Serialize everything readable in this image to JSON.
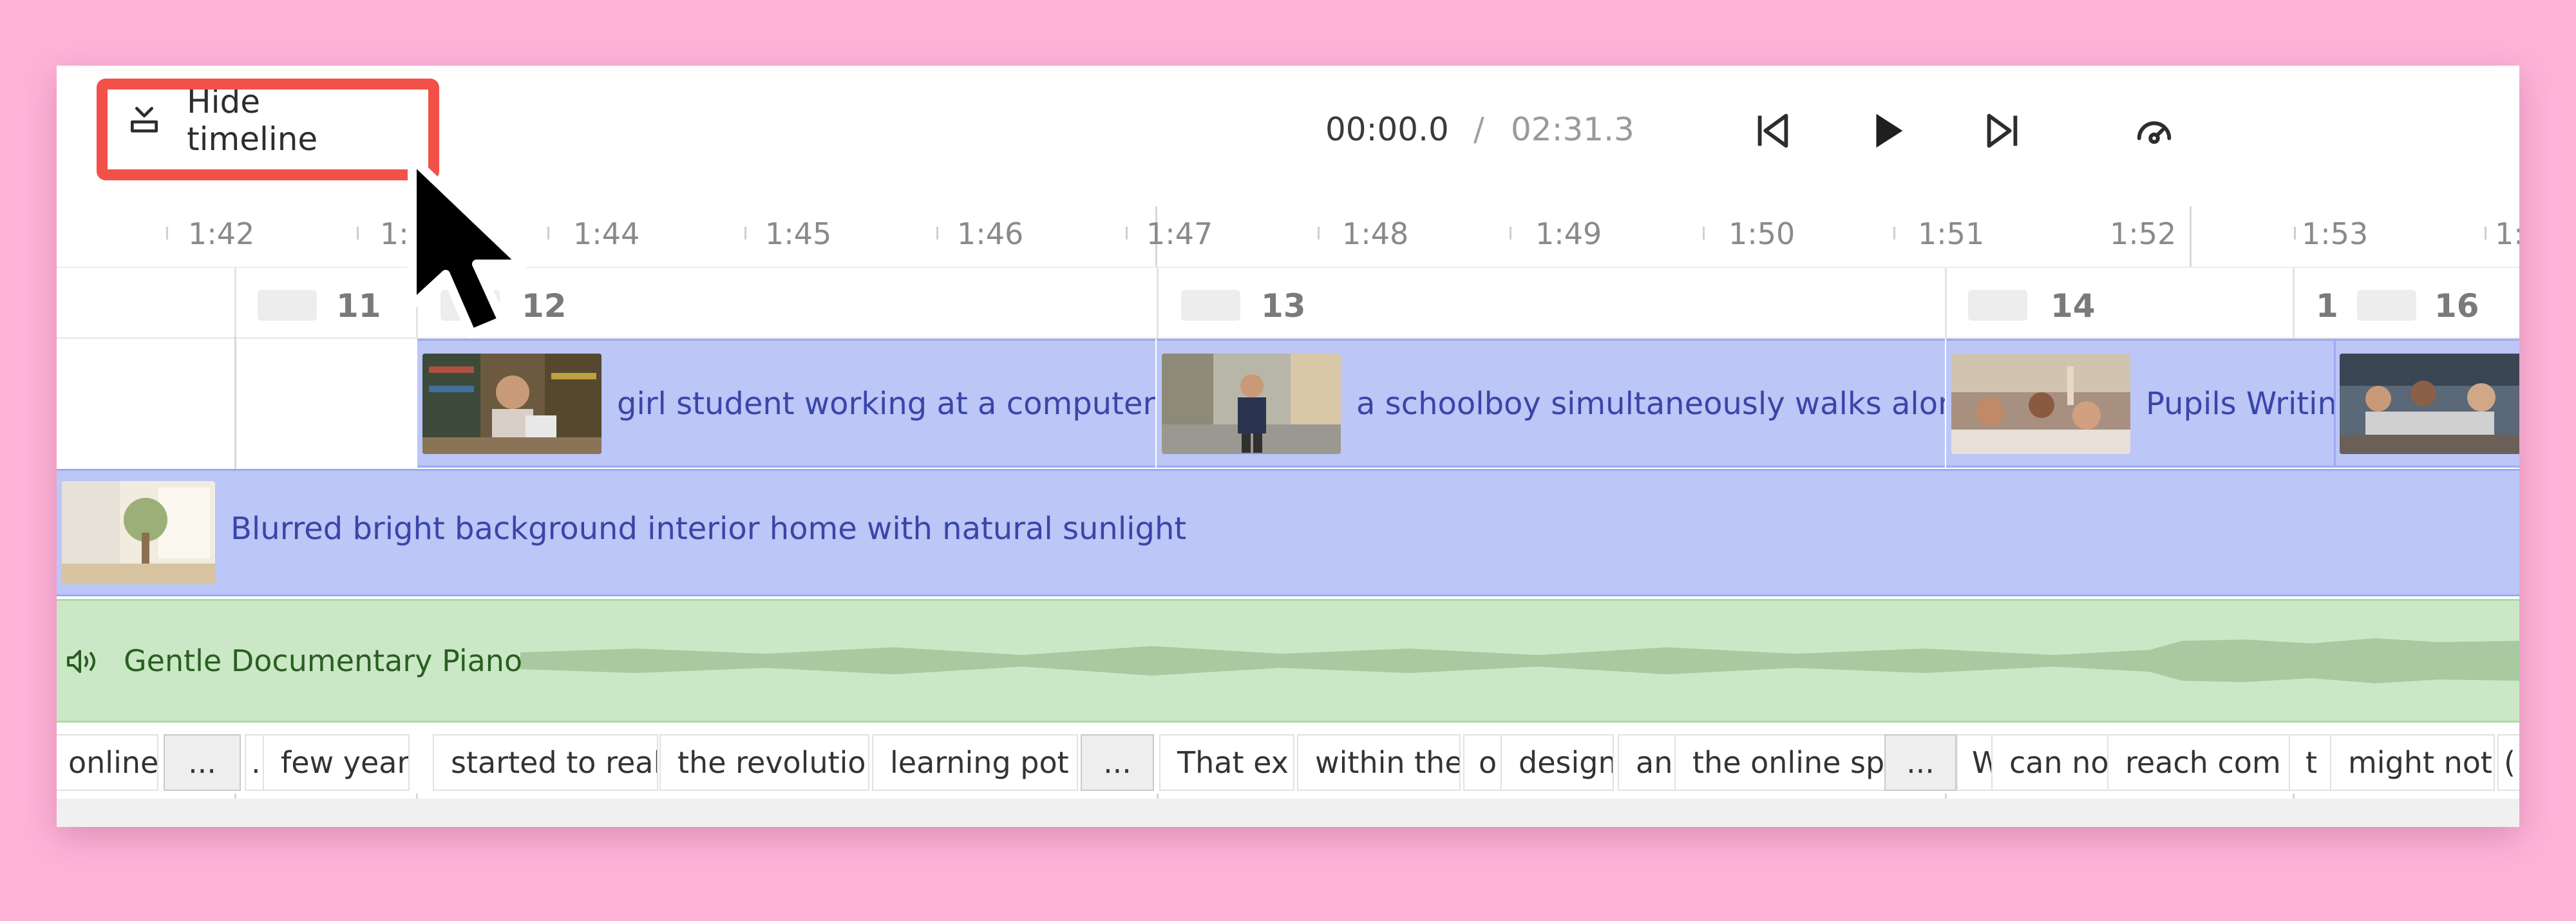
{
  "toolbar": {
    "hide_timeline_label": "Hide timeline",
    "current_time": "00:00.0",
    "separator": "/",
    "total_time": "02:31.3"
  },
  "ruler": {
    "labels": [
      "1:42",
      "1:",
      "1:44",
      "1:45",
      "1:46",
      "1:47",
      "1:48",
      "1:49",
      "1:50",
      "1:51",
      "1:52",
      "1:53",
      "1:"
    ]
  },
  "scenes": [
    "11",
    "12",
    "13",
    "14",
    "1",
    "16"
  ],
  "video_clips": [
    "girl student working at a computer in",
    "a schoolboy simultaneously walks along",
    "Pupils Writin"
  ],
  "background_clip": "Blurred bright background interior home with natural sunlight",
  "audio_clip": "Gentle Documentary Piano",
  "captions": [
    "online",
    "...",
    ".",
    "few year",
    "started to realiz",
    "the revolution",
    "learning pot",
    "...",
    "That ex",
    "within the",
    "o",
    "design",
    "an",
    "the online sp",
    "...",
    "W",
    "can no",
    "reach com",
    "t",
    "might not",
    "("
  ],
  "colors": {
    "page_background": "#ffb3d9",
    "highlight": "#f2514a",
    "video_clip": "#bcc6f7",
    "audio_clip": "#cbe8c6"
  }
}
